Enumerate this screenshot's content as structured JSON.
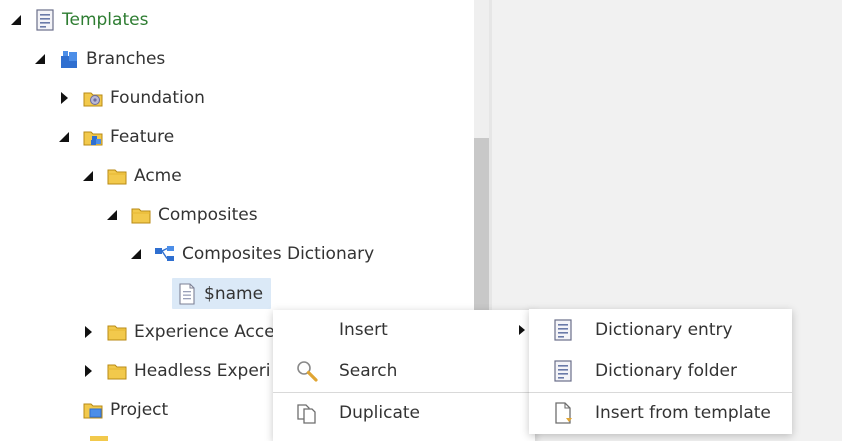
{
  "tree": {
    "items": [
      {
        "label": "Templates",
        "icon": "templates-icon"
      },
      {
        "label": "Branches",
        "icon": "branches-icon"
      },
      {
        "label": "Foundation",
        "icon": "folder-foundation-icon"
      },
      {
        "label": "Feature",
        "icon": "folder-feature-icon"
      },
      {
        "label": "Acme",
        "icon": "folder-icon"
      },
      {
        "label": "Composites",
        "icon": "folder-icon"
      },
      {
        "label": "Composites Dictionary",
        "icon": "dictionary-icon"
      },
      {
        "label": "$name",
        "icon": "document-icon"
      },
      {
        "label": "Experience Acce",
        "icon": "folder-icon"
      },
      {
        "label": "Headless Experi",
        "icon": "folder-icon"
      },
      {
        "label": "Project",
        "icon": "folder-project-icon"
      }
    ]
  },
  "context_menu": {
    "items": [
      {
        "label": "Insert",
        "icon": "",
        "has_submenu": true
      },
      {
        "label": "Search",
        "icon": "search-icon"
      },
      {
        "label": "Duplicate",
        "icon": "duplicate-icon"
      }
    ]
  },
  "submenu": {
    "items": [
      {
        "label": "Dictionary entry",
        "icon": "dictionary-entry-icon"
      },
      {
        "label": "Dictionary folder",
        "icon": "dictionary-folder-icon"
      },
      {
        "label": "Insert from template",
        "icon": "insert-from-template-icon"
      }
    ]
  },
  "colors": {
    "templates_label": "#2e7d32",
    "selection": "#dbe9f7",
    "right_pane": "#f1f1f1"
  }
}
